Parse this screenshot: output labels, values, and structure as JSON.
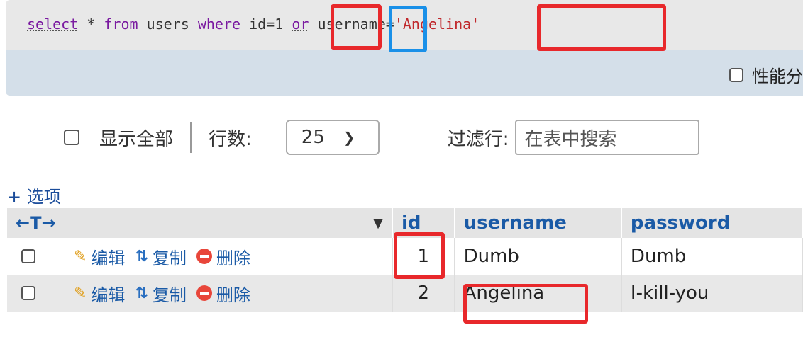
{
  "sql": {
    "select": "select",
    "star_from": " * ",
    "from": "from",
    "users": " users ",
    "where": "where",
    "cond1": " id=1 ",
    "or": "or",
    "cond2": " username=",
    "value": "'Angelina'"
  },
  "performance_label": "性能分",
  "nav": {
    "show_all": "显示全部",
    "rows_label": "行数:",
    "rows_value": "25",
    "filter_label": "过滤行:",
    "filter_placeholder": "在表中搜索"
  },
  "options_label": "+ 选项",
  "table": {
    "columns": [
      "id",
      "username",
      "password"
    ],
    "arrows": "←T→",
    "edit": "编辑",
    "copy": "复制",
    "delete": "删除",
    "rows": [
      {
        "id": "1",
        "username": "Dumb",
        "password": "Dumb"
      },
      {
        "id": "2",
        "username": "Angelina",
        "password": "I-kill-you"
      }
    ]
  },
  "colors": {
    "highlight_red": "#e8282b",
    "highlight_blue": "#1a90e8"
  }
}
